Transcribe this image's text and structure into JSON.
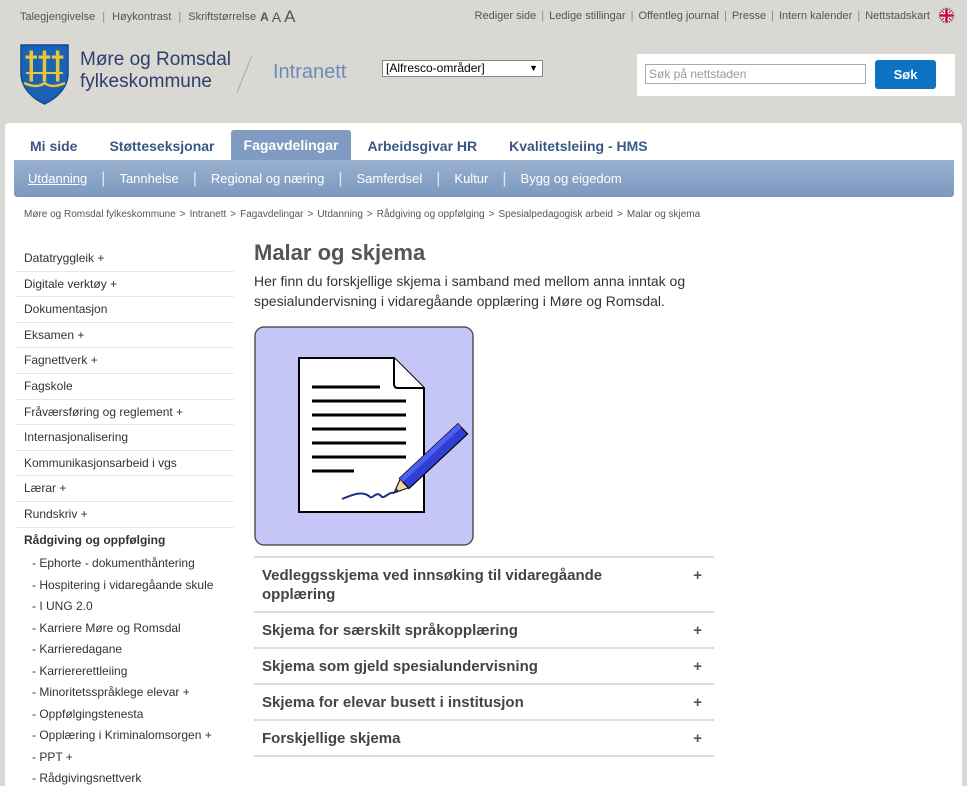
{
  "utility": {
    "talegjengivelse": "Talegjengivelse",
    "hoykontrast": "Høykontrast",
    "skriftstorrelse": "Skriftstørrelse",
    "font_a": [
      "A",
      "A",
      "A"
    ],
    "right_links": [
      "Rediger side",
      "Ledige stillingar",
      "Offentleg journal",
      "Presse",
      "Intern kalender",
      "Nettstadskart"
    ]
  },
  "header": {
    "org_line1": "Møre og Romsdal",
    "org_line2": "fylkeskommune",
    "site": "Intranett",
    "alfresco_select": "[Alfresco-områder]",
    "search_placeholder": "Søk på nettstaden",
    "search_button": "Søk"
  },
  "tabs": [
    {
      "label": "Mi side"
    },
    {
      "label": "Støtteseksjonar"
    },
    {
      "label": "Fagavdelingar",
      "active": true
    },
    {
      "label": "Arbeidsgivar HR"
    },
    {
      "label": "Kvalitetsleiing - HMS"
    }
  ],
  "subnav": [
    "Utdanning",
    "Tannhelse",
    "Regional og næring",
    "Samferdsel",
    "Kultur",
    "Bygg og eigedom"
  ],
  "breadcrumb": [
    "Møre og Romsdal fylkeskommune",
    "Intranett",
    "Fagavdelingar",
    "Utdanning",
    "Rådgiving og oppfølging",
    "Spesialpedagogisk arbeid",
    "Malar og skjema"
  ],
  "leftnav": {
    "items": [
      "Datatryggleik +",
      "Digitale verktøy +",
      "Dokumentasjon",
      "Eksamen +",
      "Fagnettverk +",
      "Fagskole",
      "Fråværsføring og reglement +",
      "Internasjonalisering",
      "Kommunikasjonsarbeid i vgs",
      "Lærar +",
      "Rundskriv +"
    ],
    "current": "Rådgiving og oppfølging",
    "subitems": [
      "- Ephorte - dokumenthåntering",
      "- Hospitering i vidaregåande skule",
      "- I UNG 2.0",
      "- Karriere Møre og Romsdal",
      "- Karrieredagane",
      "- Karriererettleiing",
      "- Minoritetsspråklege elevar +",
      "- Oppfølgingstenesta",
      "- Opplæring i Kriminalomsorgen +",
      "- PPT +",
      "- Rådgivingsnettverk"
    ]
  },
  "main": {
    "title": "Malar og skjema",
    "intro": "Her finn du forskjellige skjema i samband med mellom anna inntak og spesialundervisning i vidaregåande opplæring i Møre og Romsdal.",
    "accordion": [
      "Vedleggsskjema ved innsøking til vidaregåande opplæring",
      "Skjema for særskilt språkopplæring",
      "Skjema som gjeld spesialundervisning",
      "Skjema for elevar busett i institusjon",
      "Forskjellige skjema"
    ],
    "plus": "+"
  },
  "colors": {
    "accent_blue": "#0d72c1",
    "tab_active": "#7f9bc2",
    "nav_text": "#3a5887",
    "page_bg": "#dad8d2"
  }
}
